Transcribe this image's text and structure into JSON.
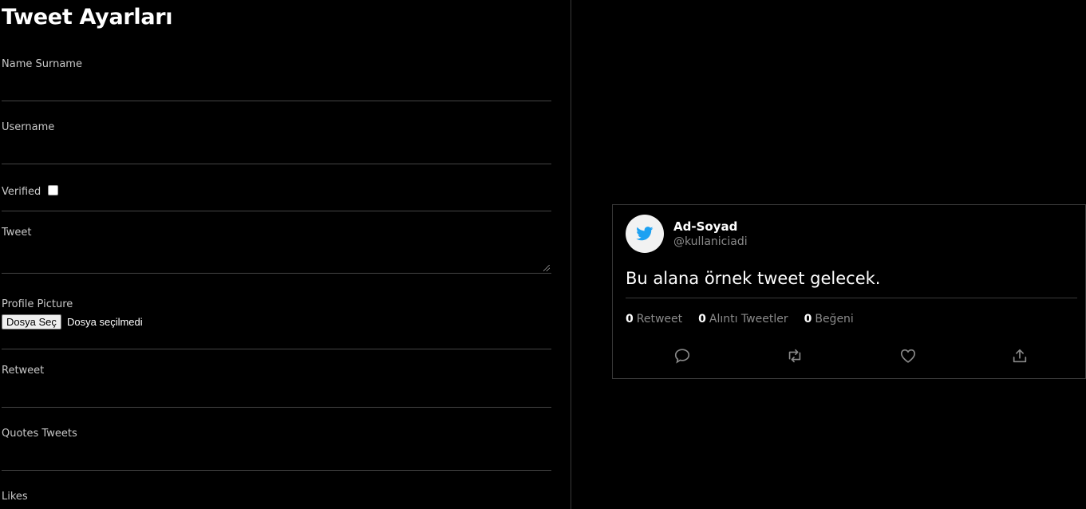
{
  "settings": {
    "title": "Tweet Ayarları",
    "name_label": "Name Surname",
    "username_label": "Username",
    "verified_label": "Verified",
    "tweet_label": "Tweet",
    "profile_picture_label": "Profile Picture",
    "file_button": "Dosya Seç",
    "file_status": "Dosya seçilmedi",
    "retweet_label": "Retweet",
    "quotes_label": "Quotes Tweets",
    "likes_label": "Likes"
  },
  "tweet": {
    "display_name": "Ad-Soyad",
    "handle": "@kullaniciadi",
    "text": "Bu alana örnek tweet gelecek.",
    "retweet_count": "0",
    "retweet_label": "Retweet",
    "quote_count": "0",
    "quote_label": "Alıntı Tweetler",
    "like_count": "0",
    "like_label": "Beğeni",
    "avatar_icon": "twitter-bird-icon",
    "colors": {
      "brand": "#1da1f2",
      "muted": "#8a8a8a"
    }
  }
}
